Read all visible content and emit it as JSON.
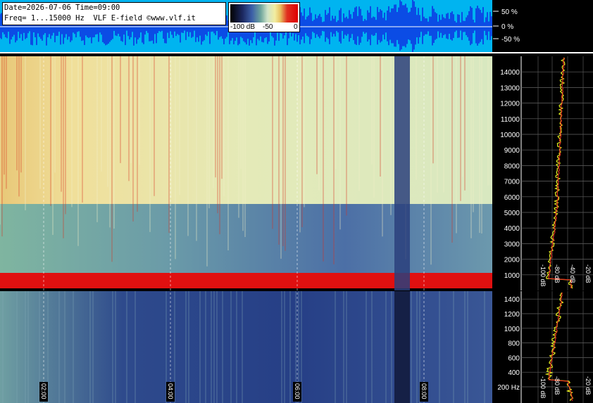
{
  "header": {
    "line1": "Date=2026-07-06 Time=09:00",
    "line2": "Freq= 1...15000 Hz  VLF E-field ©www.vlf.it"
  },
  "colorbar": {
    "labels": [
      "-100 dB",
      "-50",
      "0"
    ]
  },
  "chart_data": [
    {
      "type": "area",
      "description_id": "waveform",
      "y_ticks": [
        "50 %",
        "0 %",
        "-50 %"
      ],
      "y_values": [
        50,
        0,
        -50
      ]
    },
    {
      "type": "heatmap",
      "description_id": "spectrogram-full",
      "y_unit": "Hz",
      "y_ticks": [
        1000,
        2000,
        3000,
        4000,
        5000,
        6000,
        7000,
        8000,
        9000,
        10000,
        11000,
        12000,
        13000,
        14000
      ],
      "ylim": [
        0,
        15000
      ],
      "bands": [
        {
          "from": 0,
          "to": 600,
          "level": "red"
        },
        {
          "from": 600,
          "to": 5300,
          "level": "green-blue"
        },
        {
          "from": 5300,
          "to": 15000,
          "level": "yellow-red"
        }
      ]
    },
    {
      "type": "heatmap",
      "description_id": "spectrogram-low",
      "y_ticks": [
        "200 Hz",
        "400",
        "600",
        "800",
        "1000",
        "1200",
        "1400"
      ],
      "ylim": [
        0,
        1500
      ]
    },
    {
      "type": "line",
      "description_id": "spectrum-profile-upper",
      "x_ticks": [
        "-100 dB",
        "-80 dB",
        "-40 dB",
        "-20 dB"
      ]
    },
    {
      "type": "line",
      "description_id": "spectrum-profile-lower",
      "x_ticks": [
        "-100 dB",
        "-80 dB",
        "-20 dB"
      ]
    }
  ],
  "time_labels": [
    "02:00",
    "04:00",
    "06:00",
    "08:00"
  ]
}
